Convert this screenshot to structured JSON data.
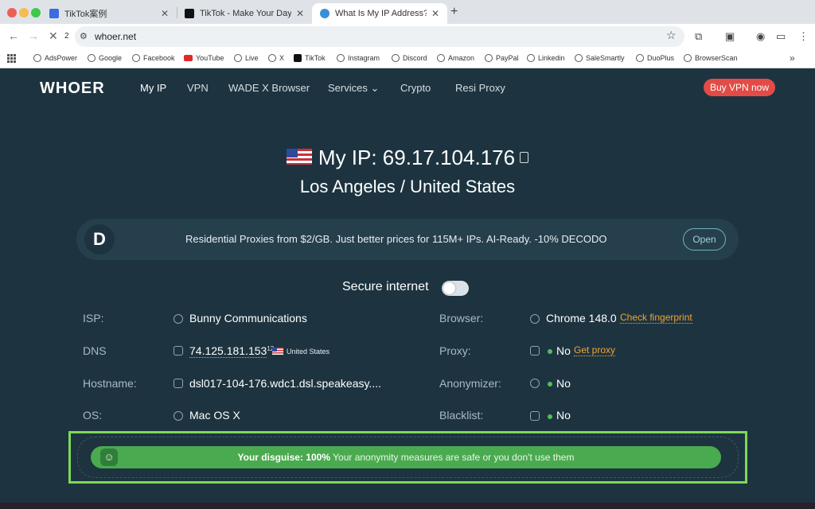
{
  "browser": {
    "tabs": [
      {
        "title": "TikTok案例",
        "active": false
      },
      {
        "title": "TikTok - Make Your Day",
        "active": false
      },
      {
        "title": "What Is My IP Address? - Find",
        "active": true
      }
    ],
    "nav_count": "2",
    "url": "whoer.net",
    "bookmarks": [
      "AdsPower",
      "Google",
      "Facebook",
      "YouTube",
      "Live",
      "X",
      "TikTok",
      "Instagram",
      "Discord",
      "Amazon",
      "PayPal",
      "Linkedin",
      "SaleSmartly",
      "DuoPlus",
      "BrowserScan"
    ]
  },
  "site": {
    "logo": "WHOER",
    "nav": [
      "My IP",
      "VPN",
      "WADE X Browser",
      "Services ⌄",
      "Crypto",
      "Resi Proxy"
    ],
    "buy_vpn": "Buy VPN now"
  },
  "hero": {
    "ip_label": "My IP: 69.17.104.176",
    "location": "Los Angeles / United States"
  },
  "promo": {
    "logo_letter": "D",
    "text": "Residential Proxies from $2/GB. Just better prices for 115M+ IPs. AI-Ready. -10% DECODO",
    "button": "Open"
  },
  "secure_internet": {
    "label": "Secure internet",
    "enabled": false
  },
  "info": {
    "isp_label": "ISP:",
    "isp_value": "Bunny Communications",
    "dns_label": "DNS",
    "dns_value": "74.125.181.153",
    "dns_count": "12",
    "dns_country": "United States",
    "hostname_label": "Hostname:",
    "hostname_value": "dsl017-104-176.wdc1.dsl.speakeasy....",
    "os_label": "OS:",
    "os_value": "Mac OS X",
    "browser_label": "Browser:",
    "browser_value": "Chrome 148.0",
    "browser_link": "Check fingerprint",
    "proxy_label": "Proxy:",
    "proxy_value": "No",
    "proxy_link": "Get proxy",
    "anonymizer_label": "Anonymizer:",
    "anonymizer_value": "No",
    "blacklist_label": "Blacklist:",
    "blacklist_value": "No"
  },
  "disguise": {
    "label": "Your disguise: 100%",
    "message": "Your anonymity measures are safe or you don't use them",
    "percent": 100
  },
  "colors": {
    "page_bg": "#1d3440",
    "accent_red": "#e34b46",
    "link_orange": "#f0a336",
    "status_green": "#4aaa4f",
    "highlight_frame": "#7ed957"
  }
}
